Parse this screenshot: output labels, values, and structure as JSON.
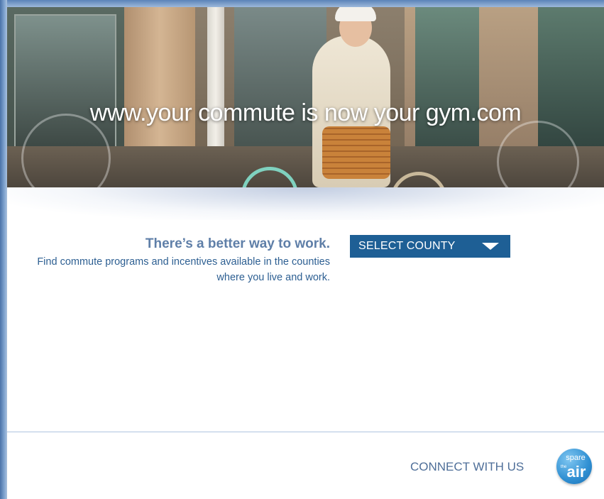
{
  "hero": {
    "tagline": "www.your commute is now your gym.com"
  },
  "promo": {
    "title": "There’s a better way to work.",
    "description": "Find commute programs and incentives available in the counties where you live and work."
  },
  "county_select": {
    "selected": "SELECT COUNTY",
    "icon": "caret-down-icon"
  },
  "footer": {
    "connect_label": "CONNECT WITH US",
    "logo_text_1": "spare",
    "logo_text_2": "the",
    "logo_text_3": "air",
    "logo_icon": "spare-the-air-logo"
  },
  "colors": {
    "frame": "#5d82b3",
    "accent": "#1e5f95",
    "title": "#5f7fa8",
    "link": "#2d5f92"
  }
}
